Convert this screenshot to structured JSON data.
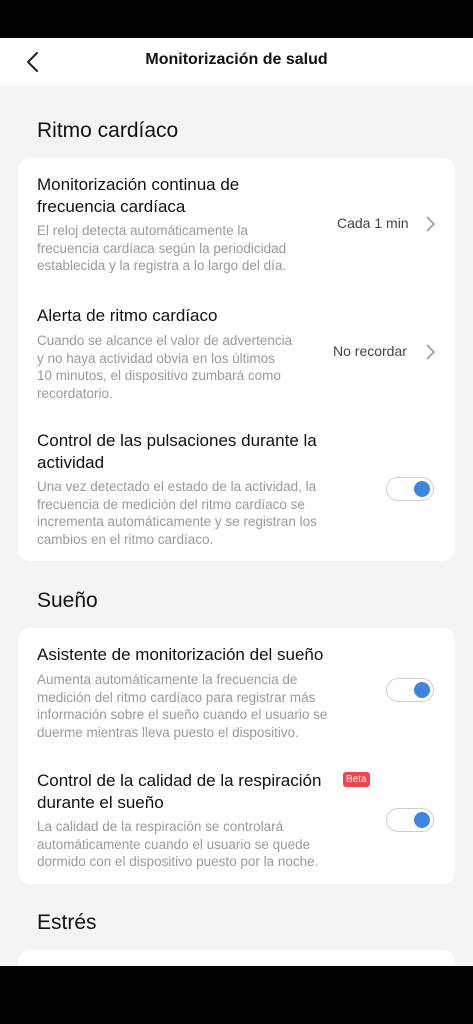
{
  "header": {
    "title": "Monitorización de salud"
  },
  "sections": [
    {
      "title": "Ritmo cardíaco",
      "items": [
        {
          "title_lines": [
            "Monitorización continua de",
            "frecuencia cardíaca"
          ],
          "desc_lines": [
            "El reloj detecta automáticamente la",
            "frecuencia cardíaca según la periodicidad",
            "establecida y la registra a lo largo del día."
          ],
          "value": "Cada 1 min"
        },
        {
          "title_lines": [
            "Alerta de ritmo cardíaco"
          ],
          "desc_lines": [
            "Cuando se alcance el valor de advertencia",
            "y no haya actividad obvia en los últimos",
            "10 minutos, el dispositivo zumbará como",
            "recordatorio."
          ],
          "value": "No recordar"
        },
        {
          "title_lines": [
            "Control de las pulsaciones durante la",
            "actividad"
          ],
          "desc_lines": [
            "Una vez detectado el estado de la actividad, la",
            "frecuencia de medición del ritmo cardíaco se",
            "incrementa automáticamente y se registran los",
            "cambios en el ritmo cardíaco."
          ],
          "toggle_on": true
        }
      ]
    },
    {
      "title": "Sueño",
      "items": [
        {
          "title_lines": [
            "Asistente de monitorización del sueño"
          ],
          "desc_lines": [
            "Aumenta automáticamente la frecuencia de",
            "medición del ritmo cardíaco para registrar más",
            "información sobre el sueño cuando el usuario se",
            "duerme mientras lleva puesto el dispositivo."
          ],
          "toggle_on": true
        },
        {
          "title_lines": [
            "Control de la calidad de la respiración",
            "durante el sueño"
          ],
          "badge": "Beta",
          "desc_lines": [
            "La calidad de la respiración se controlará",
            "automáticamente cuando el usuario se quede",
            "dormido con el dispositivo puesto por la noche."
          ],
          "toggle_on": true
        }
      ]
    },
    {
      "title": "Estrés"
    }
  ],
  "colors": {
    "accent": "#3d85e0",
    "badge": "#f0454b",
    "background": "#f4f4f4"
  }
}
